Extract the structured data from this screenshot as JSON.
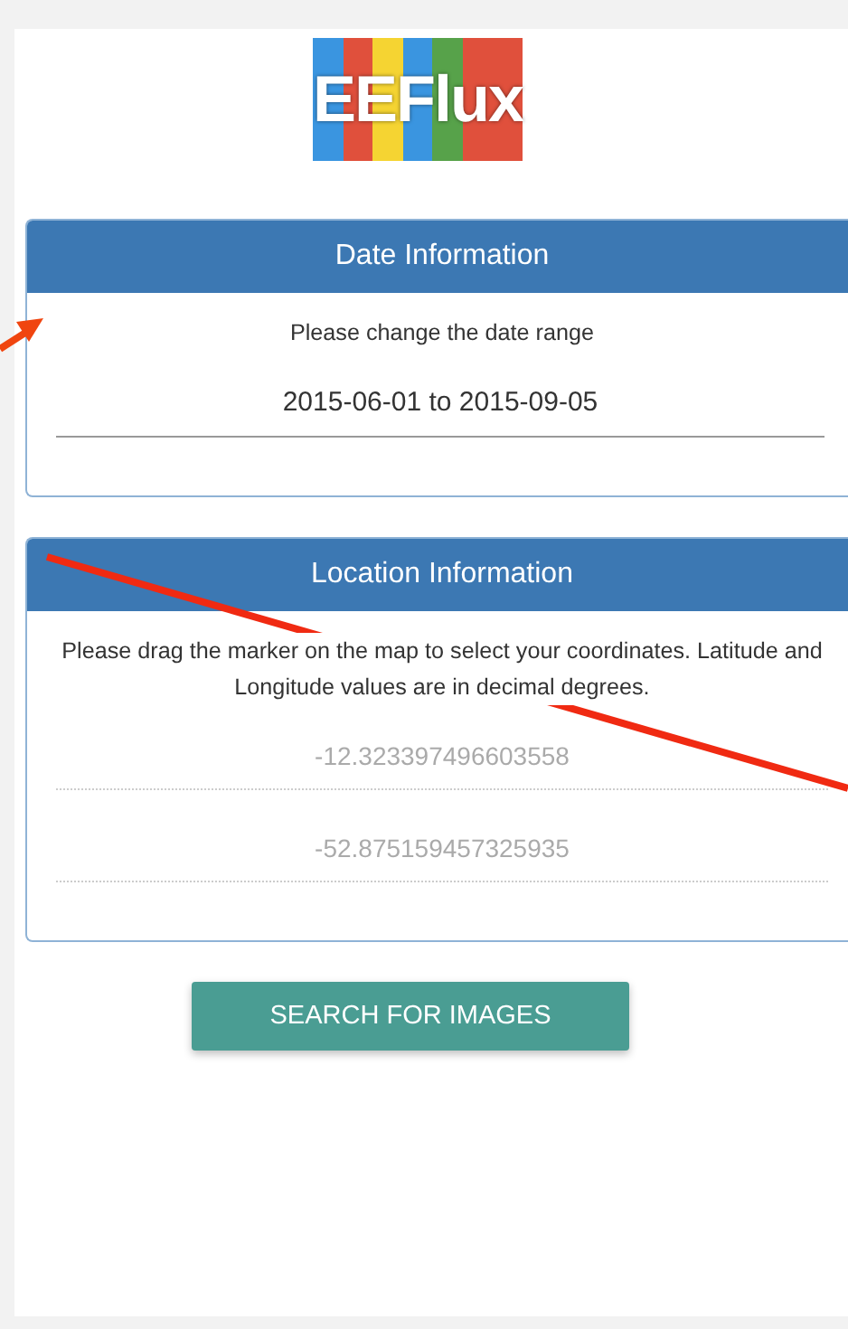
{
  "logo": {
    "text": "EEFlux"
  },
  "panels": [
    {
      "title": "Date Information",
      "intro": "Please change the date range",
      "fields": [
        {
          "kind": "date",
          "value": "2015-06-01 to 2015-09-05",
          "disabled": false
        }
      ]
    },
    {
      "title": "Location Information",
      "intro": "Please drag the marker on the map to select your coordinates. Latitude and Longitude values are in decimal degrees.",
      "fields": [
        {
          "kind": "coordinate",
          "value": "-12.323397496603558",
          "disabled": true
        },
        {
          "kind": "coordinate",
          "value": "-52.875159457325935",
          "disabled": true
        }
      ]
    }
  ],
  "button": {
    "label": "SEARCH FOR IMAGES"
  }
}
